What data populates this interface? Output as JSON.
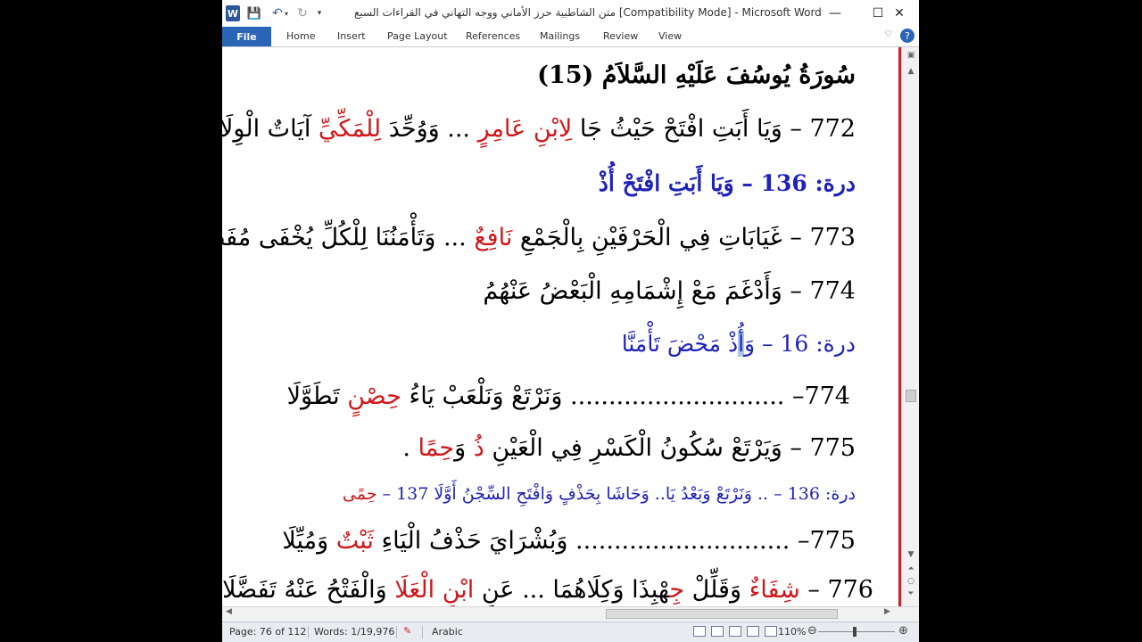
{
  "window": {
    "title": "متن الشاطبية حرز الأماني ووجه التهاني في القراءات السبع [Compatibility Mode] - Microsoft Word",
    "app_icon": "W",
    "quick_access": {
      "save": "💾",
      "undo": "↶",
      "undo_drop": "▾",
      "redo": "↻",
      "customize": "▾"
    },
    "controls": {
      "help": "?",
      "minimize": "—",
      "maximize": "☐",
      "close": "✕"
    }
  },
  "ribbon": {
    "file_label": "File",
    "tabs": [
      "Home",
      "Insert",
      "Page Layout",
      "References",
      "Mailings",
      "Review",
      "View"
    ],
    "caret": "♡",
    "help": "?"
  },
  "document": {
    "heading": "سُورَةُ يُوسُفَ عَلَيْهِ السَّلاَمُ (15)",
    "l772": {
      "a": "772 – وَيَا أَبَتِ افْتَحْ حَيْثُ جَا ",
      "b": "لِابْنِ عَامِرٍ",
      "c": " ... وَوُحِّدَ ",
      "d": "لِلْمَكِّيِّ",
      "e": " آيَاتٌ الْوِلَا"
    },
    "dura136": "درة: 136 – وَيَا أَبَتِ افْتَحْ أُذْ",
    "l773": {
      "a": "773 – غَيَابَاتِ فِي الْحَرْفَيْنِ بِالْجَمْعِ ",
      "b": "نَافِعٌ",
      "c": " ... وَتَأْمَنُنَا لِلْكُلِّ يُخْفَى مُفَصَّلَا"
    },
    "l774": "774 – وَأَدْغَمَ مَعْ إِشْمَامِهِ الْبَعْضُ عَنْهُمُ",
    "dura16": {
      "a": "درة: 16 – وَ",
      "sel": "أُ",
      "b": "ذْ مَحْضَ تَأْمَنَّا"
    },
    "l774b": {
      "a": "774– ............................ وَنَرْتَعْ وَنَلْعَبْ يَاءُ ",
      "b": "حِصْنٍ",
      "c": " تَطَوَّلَا"
    },
    "l775": {
      "a": "775 – وَيَرْتَعْ سُكُونُ الْكَسْرِ فِي الْعَيْنِ ",
      "b": "ذُ",
      "c": " وَ",
      "d": "حِمًا",
      "e": " ."
    },
    "dura136b": {
      "a": "درة: 136 – .. وَنَرْتَعْ وَبَعْدُ يَا.. وَحَاشَا بِحَذْفٍ وَافْتَحِ السِّجْنُ أَوَّلَا   137 – ",
      "b": "حِمًى"
    },
    "l775b": {
      "a": "775– ............................ وَبُشْرَايَ حَذْفُ الْيَاءِ ",
      "b": "ثَبْتٌ",
      "c": " وَمُيِّلَا"
    },
    "l776": {
      "a": "776 – ",
      "b": "شِفَاءٌ",
      "c": " وَقَلِّلْ ",
      "d": "جِ",
      "e": "هْبِذَا وَكِلَاهُمَا ... عَنِ ",
      "f": "ابْنِ الْعَلَا",
      "g": " وَالْفَتْحُ عَنْهُ تَفَضَّلَا"
    }
  },
  "statusbar": {
    "page": "Page: 76 of 112",
    "words": "Words: 1/19,976",
    "language": "Arabic",
    "zoom": "110%",
    "zoom_level": 1.1
  },
  "colors": {
    "accent": "#2b65b8",
    "red_text": "#d0171a",
    "blue_text": "#1e22b8",
    "doc_border": "#c0282d"
  }
}
